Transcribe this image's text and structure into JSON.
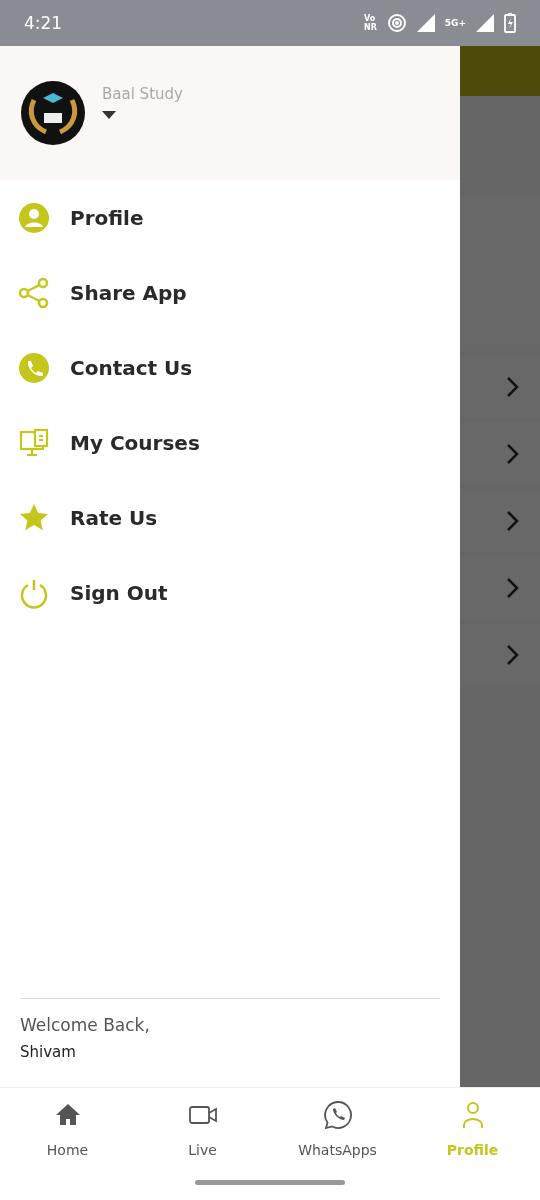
{
  "status_bar": {
    "time": "4:21",
    "network_badge": [
      "Vo",
      "NR"
    ],
    "signal_label": "5G+"
  },
  "drawer": {
    "header": {
      "title": "Baal Study"
    },
    "items": [
      {
        "kind": "profile",
        "label": "Profile"
      },
      {
        "kind": "share",
        "label": "Share App"
      },
      {
        "kind": "contact",
        "label": "Contact Us"
      },
      {
        "kind": "courses",
        "label": "My Courses"
      },
      {
        "kind": "rate",
        "label": "Rate Us"
      },
      {
        "kind": "signout",
        "label": "Sign Out"
      }
    ],
    "footer": {
      "greeting": "Welcome Back,",
      "user": "Shivam"
    }
  },
  "bottom_nav": [
    {
      "kind": "home",
      "label": "Home",
      "selected": false
    },
    {
      "kind": "live",
      "label": "Live",
      "selected": false
    },
    {
      "kind": "whatsapp",
      "label": "WhatsApps",
      "selected": false
    },
    {
      "kind": "profile",
      "label": "Profile",
      "selected": true
    }
  ]
}
